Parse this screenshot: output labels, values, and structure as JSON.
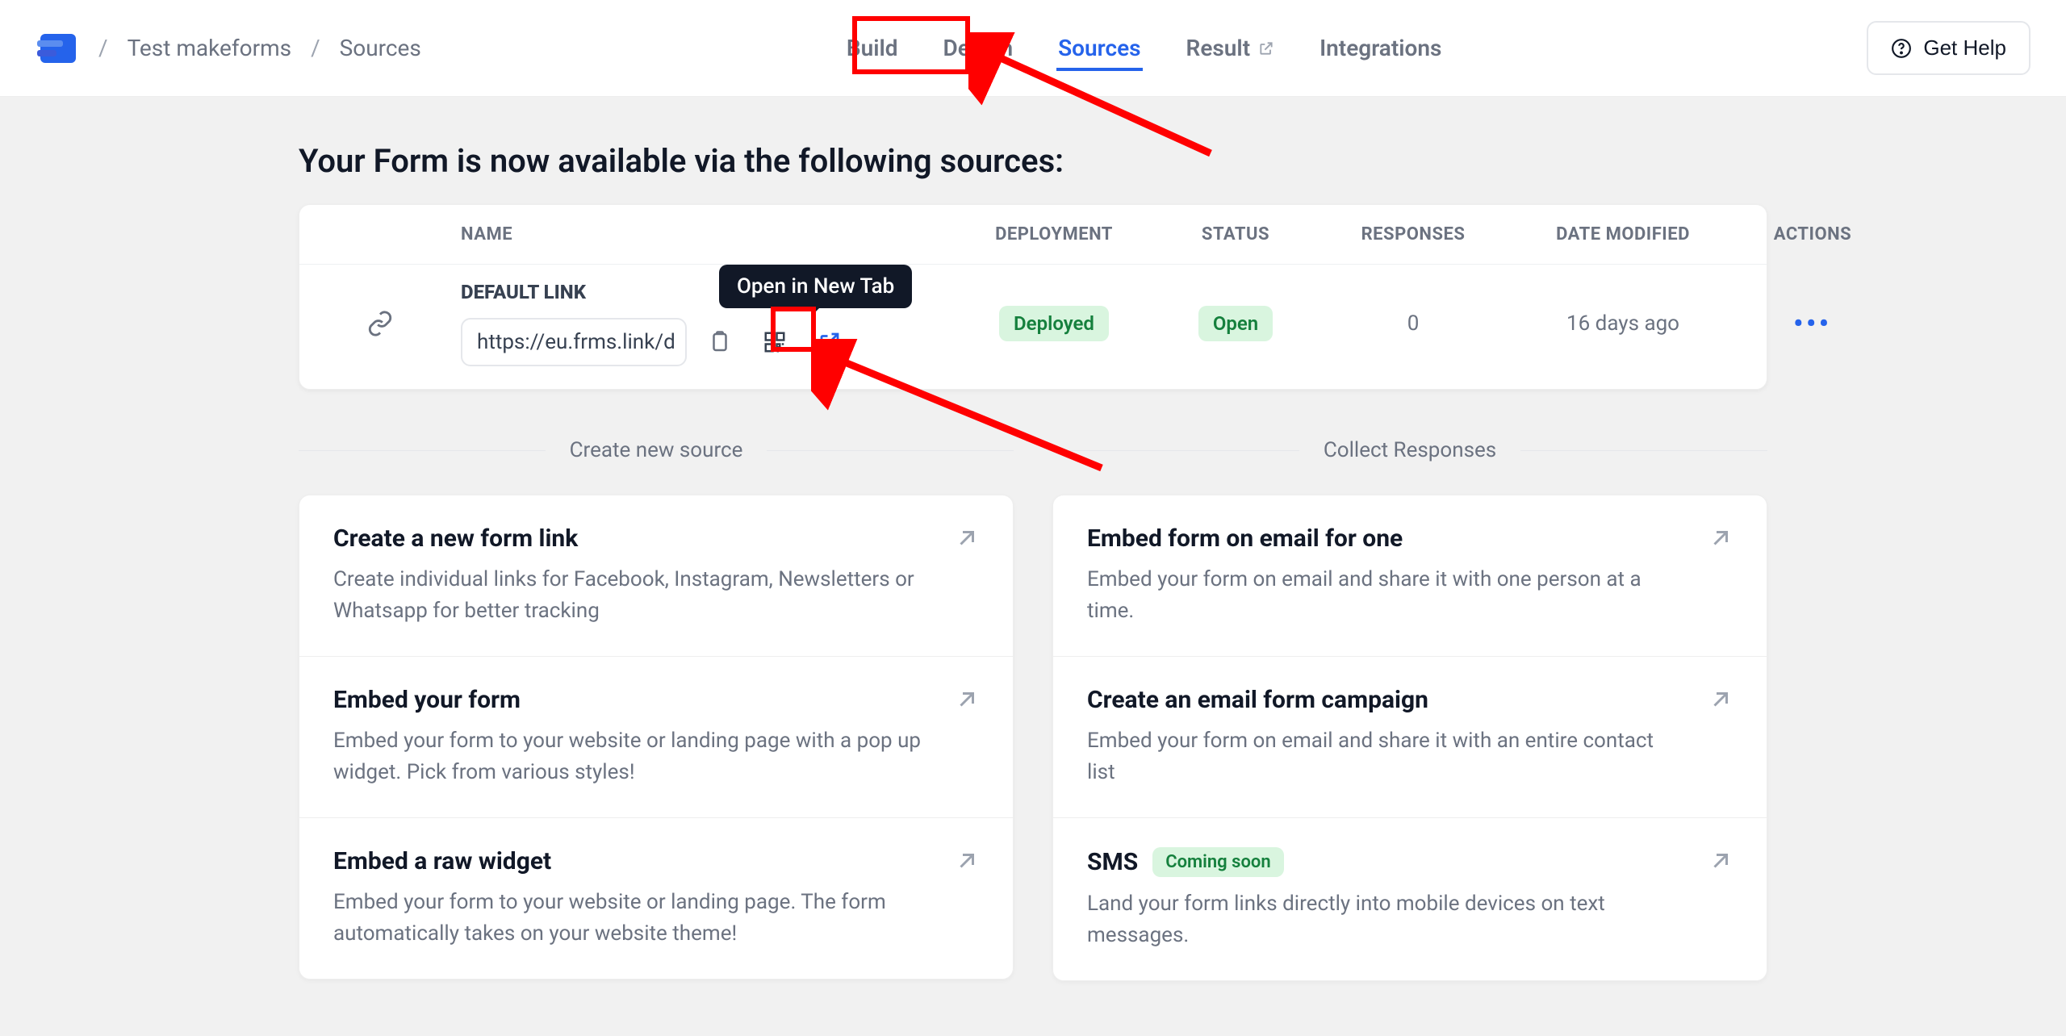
{
  "breadcrumb": {
    "item1": "Test makeforms",
    "item2": "Sources"
  },
  "nav": {
    "build": "Build",
    "design": "Design",
    "sources": "Sources",
    "result": "Result",
    "integrations": "Integrations"
  },
  "help_button": "Get Help",
  "page_title": "Your Form is now available via the following sources:",
  "table": {
    "headers": {
      "name": "NAME",
      "deployment": "DEPLOYMENT",
      "status": "STATUS",
      "responses": "RESPONSES",
      "date_modified": "DATE MODIFIED",
      "actions": "ACTIONS"
    },
    "row": {
      "type_label": "DEFAULT LINK",
      "link_value": "https://eu.frms.link/d",
      "deployment": "Deployed",
      "status": "Open",
      "responses": "0",
      "date_modified": "16 days ago"
    }
  },
  "tooltip_open_new_tab": "Open in New Tab",
  "sections": {
    "create_title": "Create new source",
    "collect_title": "Collect Responses",
    "create_cards": [
      {
        "title": "Create a new form link",
        "desc": "Create individual links for Facebook, Instagram, Newsletters or Whatsapp for better tracking"
      },
      {
        "title": "Embed your form",
        "desc": "Embed your form to your website or landing page with a pop up widget. Pick from various styles!"
      },
      {
        "title": "Embed a raw widget",
        "desc": "Embed your form to your website or landing page. The form automatically takes on your website theme!"
      }
    ],
    "collect_cards": [
      {
        "title": "Embed form on email for one",
        "desc": "Embed your form on email and share it with one person at a time."
      },
      {
        "title": "Create an email form campaign",
        "desc": "Embed your form on email and share it with an entire contact list"
      },
      {
        "title": "SMS",
        "desc": "Land your form links directly into mobile devices on text messages.",
        "badge": "Coming soon"
      }
    ]
  }
}
